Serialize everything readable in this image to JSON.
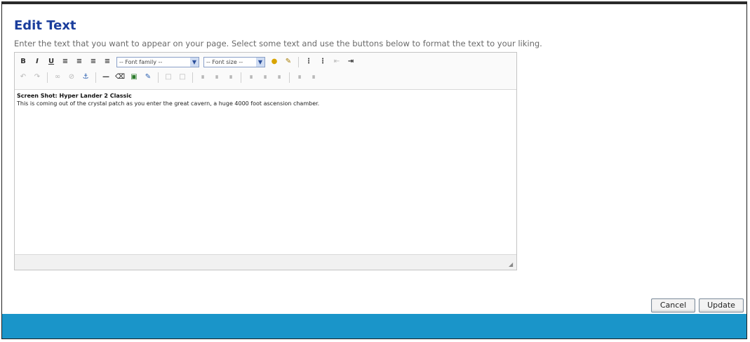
{
  "dialog": {
    "title": "Edit Text",
    "instructions": "Enter the text that you want to appear on your page. Select some text and use the buttons below to format the text to your liking."
  },
  "toolbar": {
    "row1": {
      "bold": "B",
      "italic": "I",
      "underline": "U",
      "font_family": "-- Font family --",
      "font_size": "-- Font size --"
    }
  },
  "editor": {
    "content_heading": "Screen Shot: Hyper Lander 2 Classic",
    "content_body": "This is coming out of the crystal patch as you enter the great cavern, a huge 4000 foot ascension chamber."
  },
  "buttons": {
    "cancel": "Cancel",
    "update": "Update"
  },
  "colors": {
    "title": "#1a3d9c",
    "footer_bar": "#1a95c9"
  }
}
